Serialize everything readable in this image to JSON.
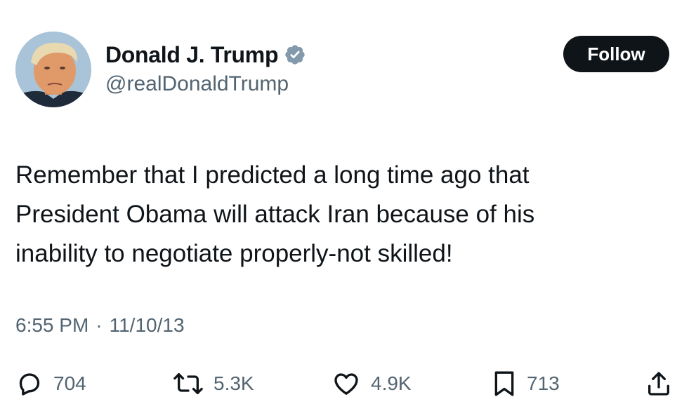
{
  "author": {
    "display_name": "Donald J. Trump",
    "handle": "@realDonaldTrump",
    "verified_icon": "verified-badge-icon",
    "avatar_icon": "avatar-photo"
  },
  "follow_button": {
    "label": "Follow"
  },
  "tweet": {
    "text_lines": [
      "Remember that I predicted a long time ago that",
      "President Obama will attack Iran because of his",
      "inability to negotiate properly-not skilled!"
    ],
    "time": "6:55 PM",
    "separator": "·",
    "date": "11/10/13"
  },
  "actions": {
    "replies": {
      "icon": "reply-icon",
      "count": "704"
    },
    "retweets": {
      "icon": "retweet-icon",
      "count": "5.3K"
    },
    "likes": {
      "icon": "like-icon",
      "count": "4.9K"
    },
    "bookmarks": {
      "icon": "bookmark-icon",
      "count": "713"
    },
    "share": {
      "icon": "share-icon"
    }
  },
  "colors": {
    "text_primary": "#0f1419",
    "text_secondary": "#536471",
    "follow_bg": "#0f1419",
    "follow_text": "#ffffff",
    "verified_badge": "#829aab"
  }
}
